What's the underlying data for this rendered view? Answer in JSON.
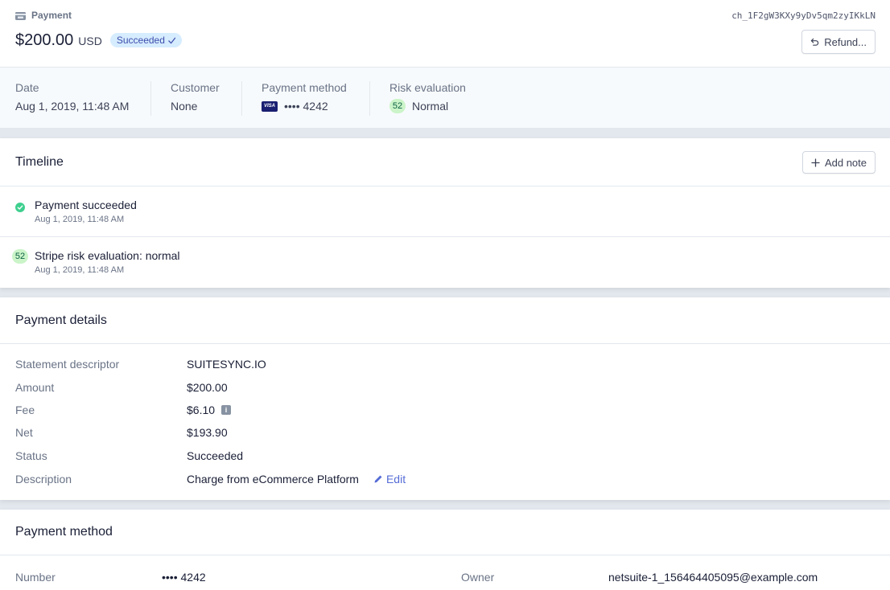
{
  "header": {
    "type_label": "Payment",
    "amount": "$200.00",
    "currency": "USD",
    "status": "Succeeded",
    "charge_id": "ch_1F2gW3KXy9yDv5qm2zyIKkLN",
    "refund_label": "Refund..."
  },
  "summary": {
    "date_label": "Date",
    "date_value": "Aug 1, 2019, 11:48 AM",
    "customer_label": "Customer",
    "customer_value": "None",
    "method_label": "Payment method",
    "method_brand": "VISA",
    "method_value": "•••• 4242",
    "risk_label": "Risk evaluation",
    "risk_score": "52",
    "risk_value": "Normal"
  },
  "timeline": {
    "title": "Timeline",
    "add_note_label": "Add note",
    "items": [
      {
        "title": "Payment succeeded",
        "time": "Aug 1, 2019, 11:48 AM"
      },
      {
        "score": "52",
        "title": "Stripe risk evaluation: normal",
        "time": "Aug 1, 2019, 11:48 AM"
      }
    ]
  },
  "details": {
    "title": "Payment details",
    "rows": [
      {
        "key": "Statement descriptor",
        "value": "SUITESYNC.IO"
      },
      {
        "key": "Amount",
        "value": "$200.00"
      },
      {
        "key": "Fee",
        "value": "$6.10"
      },
      {
        "key": "Net",
        "value": "$193.90"
      },
      {
        "key": "Status",
        "value": "Succeeded"
      },
      {
        "key": "Description",
        "value": "Charge from eCommerce Platform"
      }
    ],
    "edit_label": "Edit"
  },
  "method": {
    "title": "Payment method",
    "number_label": "Number",
    "number_value": "•••• 4242",
    "owner_label": "Owner",
    "owner_value": "netsuite-1_156464405095@example.com"
  },
  "colors": {
    "accent": "#556cd6",
    "success": "#3ecf8e",
    "badge_bg": "#d6ecff"
  }
}
